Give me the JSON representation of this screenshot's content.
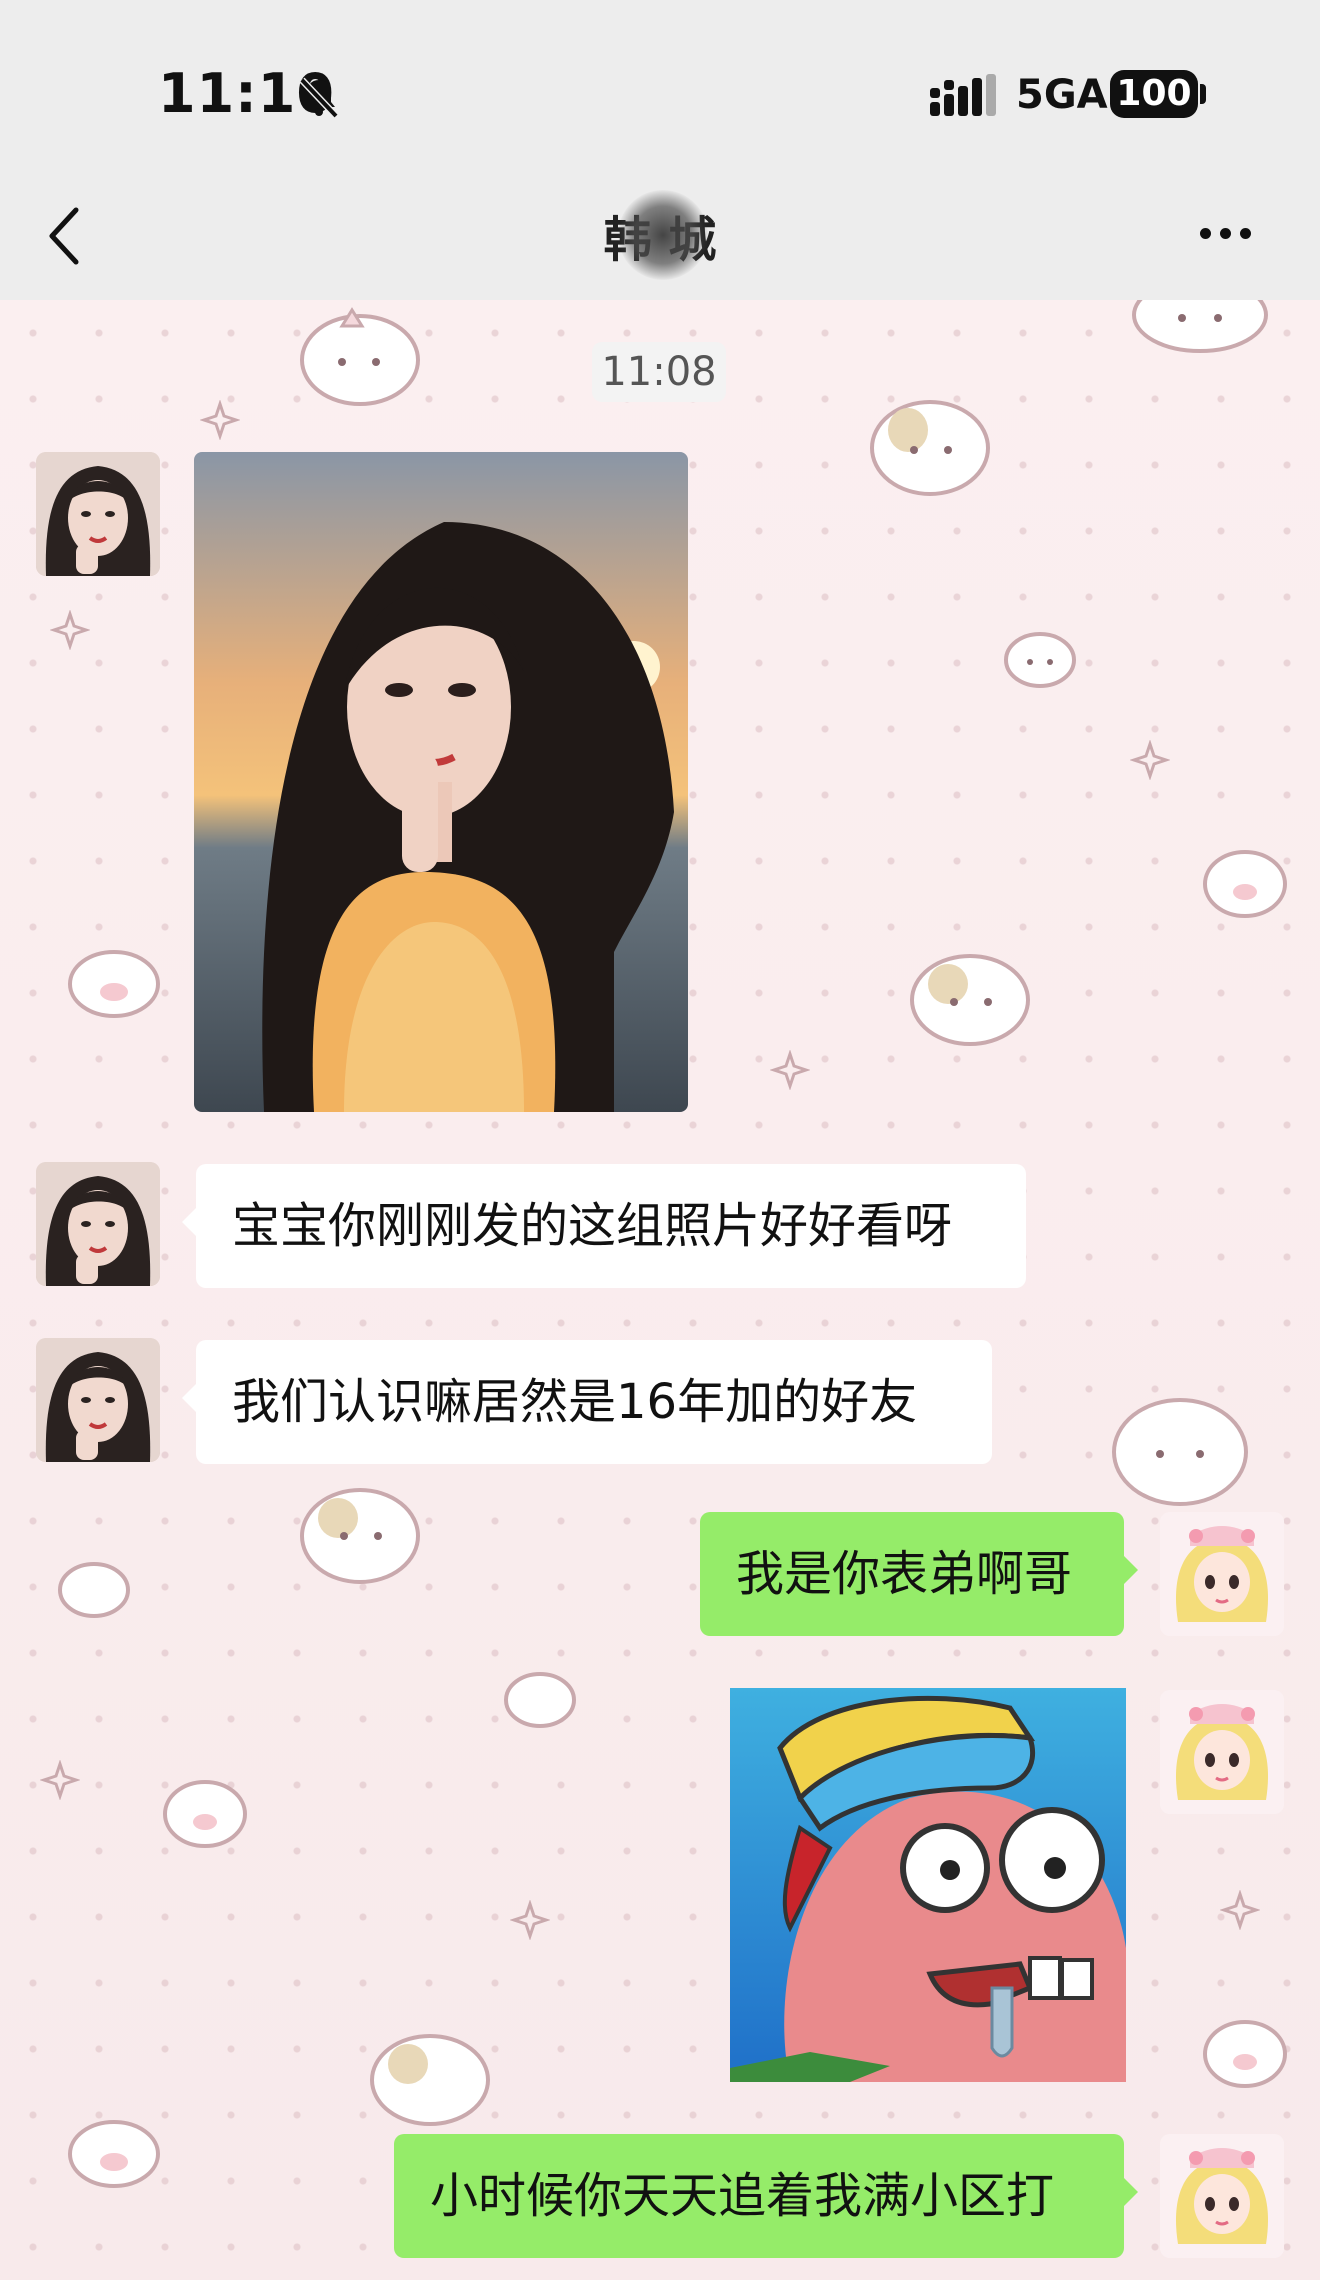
{
  "status_bar": {
    "time": "11:10",
    "network": "5GA",
    "battery": "100"
  },
  "nav": {
    "title": "韩  城",
    "title_obscured": true
  },
  "chat": {
    "timestamp": "11:08",
    "messages": [
      {
        "side": "in",
        "type": "image",
        "content": "photo"
      },
      {
        "side": "in",
        "type": "text",
        "text": "宝宝你刚刚发的这组照片好好看呀"
      },
      {
        "side": "in",
        "type": "text",
        "text": "我们认识嘛居然是16年加的好友"
      },
      {
        "side": "out",
        "type": "text",
        "text": "我是你表弟啊哥"
      },
      {
        "side": "out",
        "type": "sticker",
        "content": "cartoon-sticker"
      },
      {
        "side": "out",
        "type": "text",
        "text": "小时候你天天追着我满小区打"
      }
    ]
  },
  "colors": {
    "nav_bg": "#ededed",
    "chat_bg": "#f7e9ea",
    "bubble_in": "#ffffff",
    "bubble_out": "#95ec69"
  },
  "icons": {
    "back": "chevron-left-icon",
    "more": "more-dots-icon",
    "mute": "bell-slash-icon",
    "signal": "signal-icon"
  }
}
